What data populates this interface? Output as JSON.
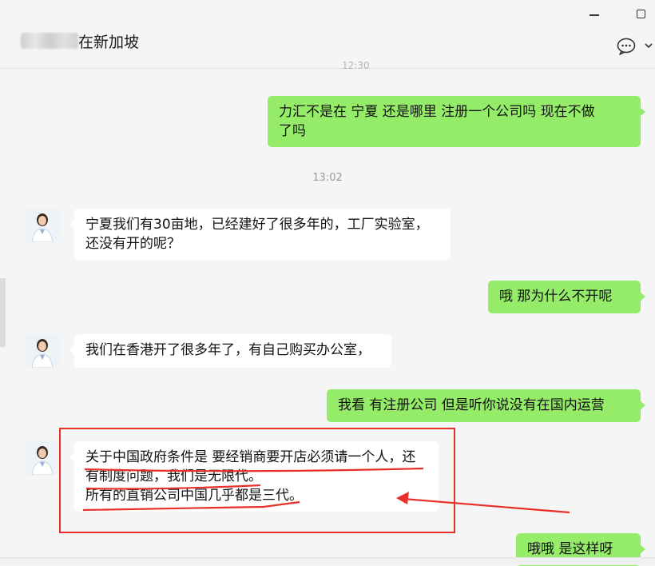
{
  "header": {
    "title_visible": "在新加坡",
    "title_blurred": true,
    "time_peek": "12:30"
  },
  "messages": [
    {
      "id": "m1",
      "side": "sent",
      "lines": [
        "力汇不是在  宁夏  还是哪里   注册一个公司吗    现在不做",
        "了吗"
      ]
    },
    {
      "id": "t1",
      "type": "time",
      "text": "13:02"
    },
    {
      "id": "m2",
      "side": "recv",
      "lines": [
        "宁夏我们有30亩地，已经建好了很多年的，工厂实验室，",
        "还没有开的呢？"
      ]
    },
    {
      "id": "m3",
      "side": "sent",
      "lines": [
        "哦    那为什么不开呢"
      ]
    },
    {
      "id": "m4",
      "side": "recv",
      "lines": [
        "我们在香港开了很多年了，有自己购买办公室，"
      ]
    },
    {
      "id": "m5",
      "side": "sent",
      "lines": [
        "我看  有注册公司    但是听你说没有在国内运营"
      ]
    },
    {
      "id": "m6",
      "side": "recv",
      "lines": [
        "关于中国政府条件是 要经销商要开店必须请一个人，还",
        "有制度问题，我们是无限代。",
        "所有的直销公司中国几乎都是三代。"
      ]
    },
    {
      "id": "m7",
      "side": "sent",
      "lines": [
        "哦哦    是这样呀"
      ]
    }
  ],
  "colors": {
    "sent_bubble": "#95ec69",
    "recv_bubble": "#ffffff",
    "annotation": "#e8302a",
    "background": "#f5f5f5"
  }
}
